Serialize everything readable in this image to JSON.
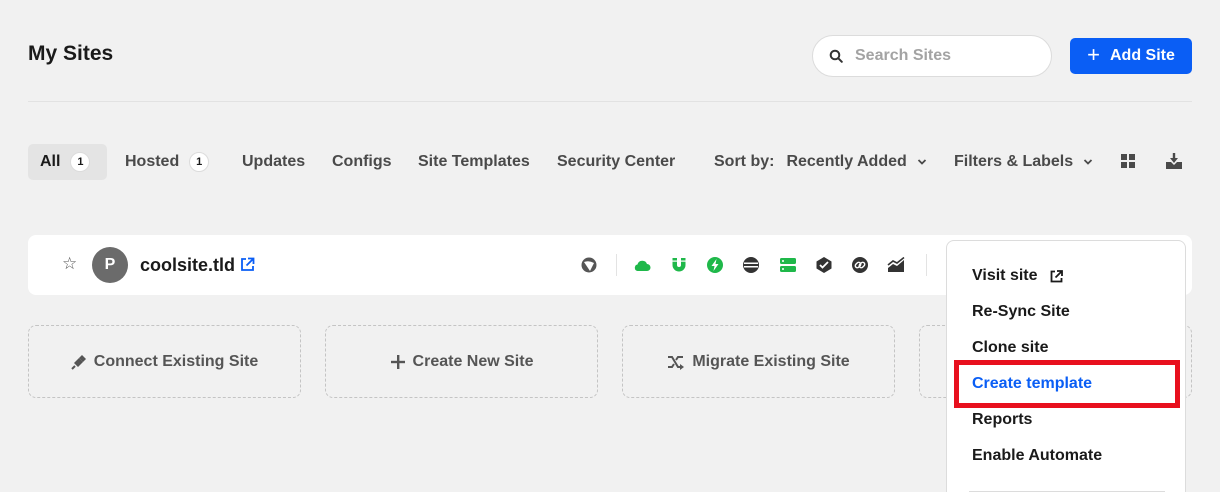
{
  "page": {
    "title": "My Sites"
  },
  "search": {
    "placeholder": "Search Sites",
    "value": ""
  },
  "add_site": {
    "label": "Add Site"
  },
  "tabs": [
    {
      "label": "All",
      "count": "1",
      "active": true
    },
    {
      "label": "Hosted",
      "count": "1"
    },
    {
      "label": "Updates"
    },
    {
      "label": "Configs"
    },
    {
      "label": "Site Templates"
    },
    {
      "label": "Security Center"
    }
  ],
  "sort": {
    "label": "Sort by:",
    "value": "Recently Added"
  },
  "filters": {
    "label": "Filters & Labels"
  },
  "view_icons": [
    "grid-view-icon",
    "download-icon"
  ],
  "site": {
    "avatar_letter": "P",
    "name": "coolsite.tld",
    "status_icons": [
      "cloud-hosting-icon",
      "magnet-icon",
      "bolt-icon",
      "database-icon",
      "server-icon",
      "plugin-icon",
      "link-icon",
      "analytics-icon"
    ]
  },
  "add_cards": [
    {
      "label": "Connect Existing Site",
      "icon": "plug-icon"
    },
    {
      "label": "Create New Site",
      "icon": "plus-icon"
    },
    {
      "label": "Migrate Existing Site",
      "icon": "migrate-icon"
    }
  ],
  "dropdown": {
    "items": [
      {
        "label": "Visit site"
      },
      {
        "label": "Re-Sync Site"
      },
      {
        "label": "Clone site"
      },
      {
        "label": "Create template",
        "highlighted": true
      },
      {
        "label": "Reports"
      },
      {
        "label": "Enable Automate"
      }
    ]
  },
  "colors": {
    "accent": "#0a5ef5",
    "status_green": "#1fb84a",
    "highlight_red": "#e8101e",
    "background": "#f1f1f1"
  }
}
